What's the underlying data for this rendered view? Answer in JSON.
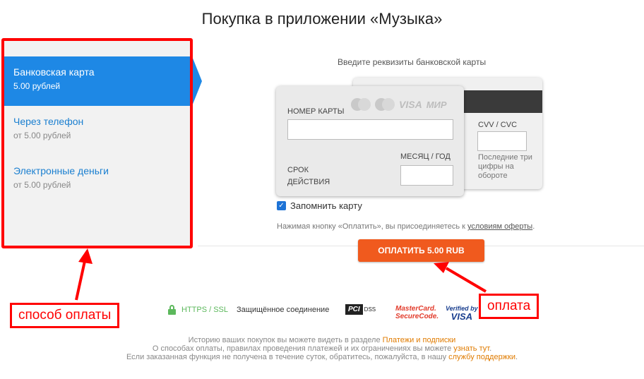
{
  "page": {
    "title": "Покупка в приложении «Музыка»"
  },
  "payment_methods": [
    {
      "name": "Банковская карта",
      "price": "5.00 рублей",
      "active": true
    },
    {
      "name": "Через телефон",
      "price": "от 5.00 рублей",
      "active": false
    },
    {
      "name": "Электронные деньги",
      "price": "от 5.00 рублей",
      "active": false
    }
  ],
  "card_form": {
    "hint": "Введите реквизиты банковской карты",
    "card_number_label": "НОМЕР КАРТЫ",
    "card_number_value": "",
    "expiry_label": "СРОК ДЕЙСТВИЯ",
    "month_year_label": "МЕСЯЦ / ГОД",
    "month_year_value": "",
    "cvv_label": "CVV / CVC",
    "cvv_value": "",
    "cvv_note": "Последние три цифры на обороте",
    "logos": {
      "visa": "VISA",
      "mir": "МИР"
    }
  },
  "remember": {
    "label": "Запомнить карту",
    "checked": true
  },
  "offer": {
    "text_before": "Нажимая кнопку «Оплатить», вы присоединяетесь к ",
    "link": "условиям оферты",
    "text_after": "."
  },
  "pay_button": {
    "label": "ОПЛАТИТЬ 5.00 RUB"
  },
  "security": {
    "https": "HTTPS / SSL",
    "secure": "Защищённое соединение",
    "pci": "PCI",
    "dss": "DSS",
    "mastercard_line1": "MasterCard.",
    "mastercard_line2": "SecureCode.",
    "verified_line1": "Verified by",
    "verified_line2": "VISA"
  },
  "footer": {
    "line1_text": "Историю ваших покупок вы можете видеть в разделе ",
    "line1_link": "Платежи и подписки",
    "line2_text": "О способах оплаты, правилах проведения платежей и их ограничениях вы можете ",
    "line2_link": "узнать тут",
    "line2_end": ".",
    "line3_text": "Если заказанная функция не получена в течение суток, обратитесь, пожалуйста, в нашу ",
    "line3_link": "службу поддержки",
    "line3_end": "."
  },
  "annotations": {
    "method": "способ оплаты",
    "pay": "оплата"
  },
  "colors": {
    "accent": "#1e88e5",
    "pay_button": "#f05a1e",
    "annotation": "#ff0000",
    "secure": "#5cb85c",
    "link": "#e07b00"
  }
}
